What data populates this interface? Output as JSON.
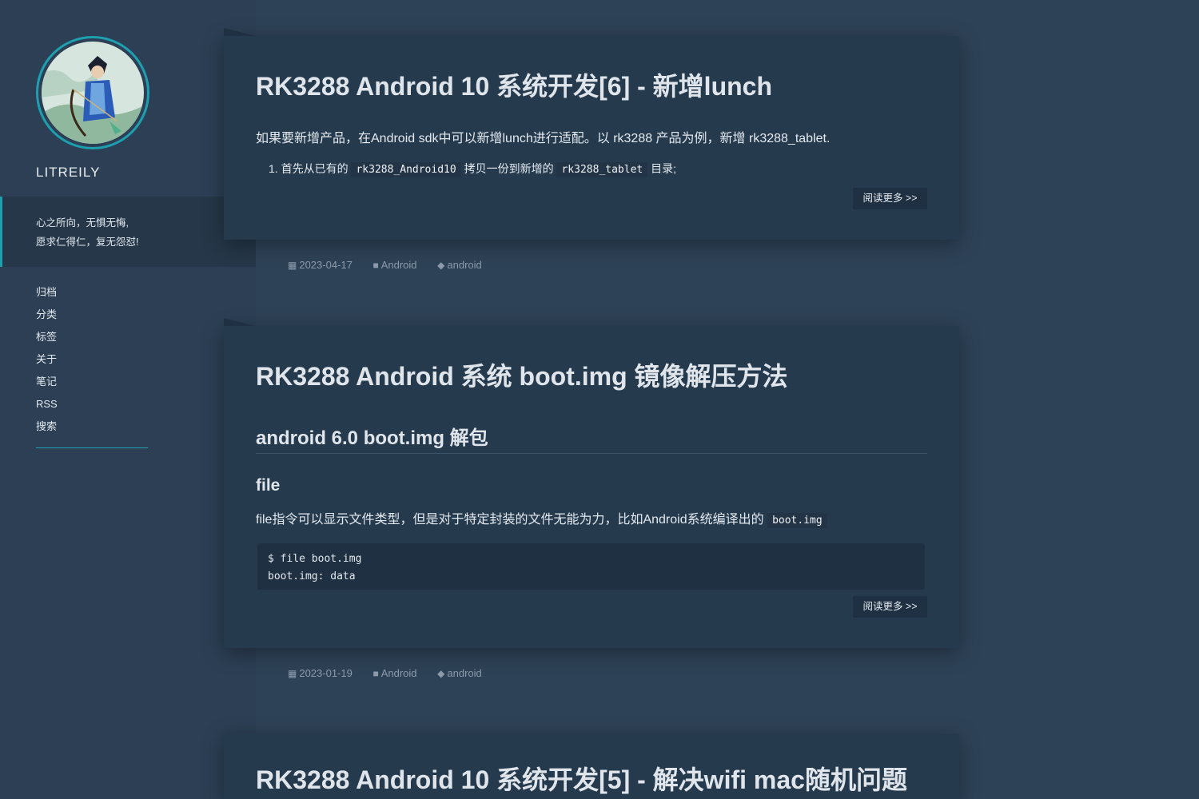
{
  "sidebar": {
    "site_name": "LITREILY",
    "motto_line1": "心之所向，无惧无悔,",
    "motto_line2": "愿求仁得仁，复无怨怼!",
    "nav": [
      {
        "label": "归档"
      },
      {
        "label": "分类"
      },
      {
        "label": "标签"
      },
      {
        "label": "关于"
      },
      {
        "label": "笔记"
      },
      {
        "label": "RSS"
      },
      {
        "label": "搜索"
      }
    ]
  },
  "posts": [
    {
      "title": "RK3288 Android 10 系统开发[6] - 新增lunch",
      "intro": "如果要新增产品，在Android sdk中可以新增lunch进行适配。以 rk3288 产品为例，新增 rk3288_tablet.",
      "list_item": {
        "number": "1.",
        "text_a": "首先从已有的",
        "code_a": "rk3288_Android10",
        "text_b": "拷贝一份到新增的",
        "code_b": "rk3288_tablet",
        "text_c": "目录;"
      },
      "read_more": "阅读更多 >>",
      "date": "2023-04-17",
      "category": "Android",
      "tag": "android"
    },
    {
      "title": "RK3288 Android 系统 boot.img 镜像解压方法",
      "h2": "android 6.0 boot.img 解包",
      "h3": "file",
      "paragraph": "file指令可以显示文件类型，但是对于特定封装的文件无能为力，比如Android系统编译出的",
      "paragraph_code": "boot.img",
      "code_lines": [
        "$ file boot.img",
        "boot.img: data"
      ],
      "read_more": "阅读更多 >>",
      "date": "2023-01-19",
      "category": "Android",
      "tag": "android"
    },
    {
      "title": "RK3288 Android 10 系统开发[5] - 解决wifi mac随机问题"
    }
  ]
}
